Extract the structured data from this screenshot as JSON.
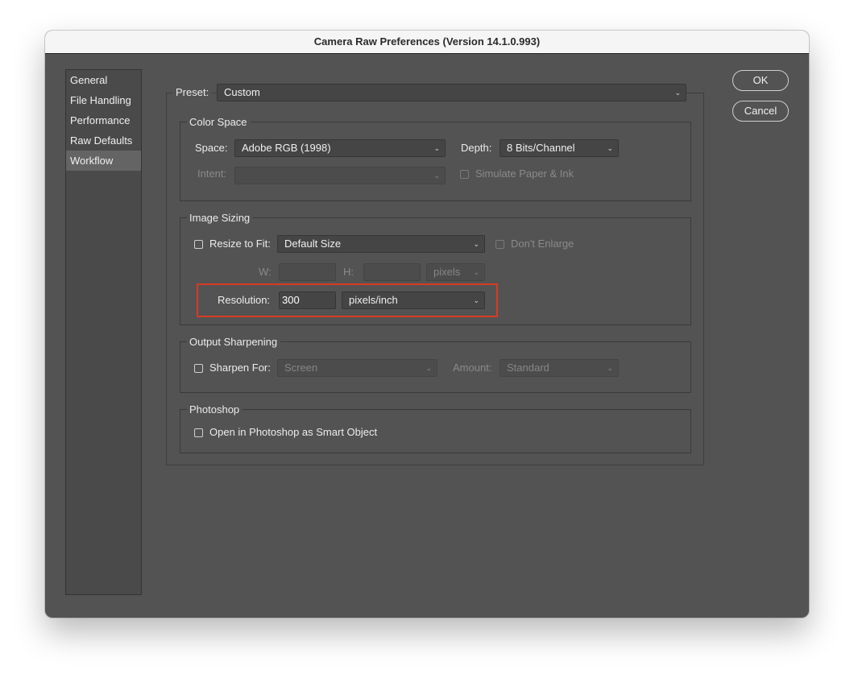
{
  "window": {
    "title": "Camera Raw Preferences  (Version 14.1.0.993)"
  },
  "sidebar": {
    "items": [
      {
        "label": "General"
      },
      {
        "label": "File Handling"
      },
      {
        "label": "Performance"
      },
      {
        "label": "Raw Defaults"
      },
      {
        "label": "Workflow",
        "selected": true
      }
    ]
  },
  "preset": {
    "label": "Preset:",
    "value": "Custom"
  },
  "color_space": {
    "legend": "Color Space",
    "space_label": "Space:",
    "space_value": "Adobe RGB (1998)",
    "depth_label": "Depth:",
    "depth_value": "8 Bits/Channel",
    "intent_label": "Intent:",
    "intent_value": "",
    "simulate_label": "Simulate Paper & Ink"
  },
  "image_sizing": {
    "legend": "Image Sizing",
    "resize_label": "Resize to Fit:",
    "resize_value": "Default Size",
    "dont_enlarge_label": "Don't Enlarge",
    "w_label": "W:",
    "w_value": "",
    "h_label": "H:",
    "h_value": "",
    "size_unit": "pixels",
    "resolution_label": "Resolution:",
    "resolution_value": "300",
    "resolution_unit": "pixels/inch"
  },
  "output_sharpening": {
    "legend": "Output Sharpening",
    "sharpen_label": "Sharpen For:",
    "sharpen_value": "Screen",
    "amount_label": "Amount:",
    "amount_value": "Standard"
  },
  "photoshop": {
    "legend": "Photoshop",
    "smart_object_label": "Open in Photoshop as Smart Object"
  },
  "buttons": {
    "ok": "OK",
    "cancel": "Cancel"
  },
  "icons": {
    "chevron": "⌄"
  },
  "colors": {
    "highlight": "#d93a23",
    "panel": "#535353"
  }
}
